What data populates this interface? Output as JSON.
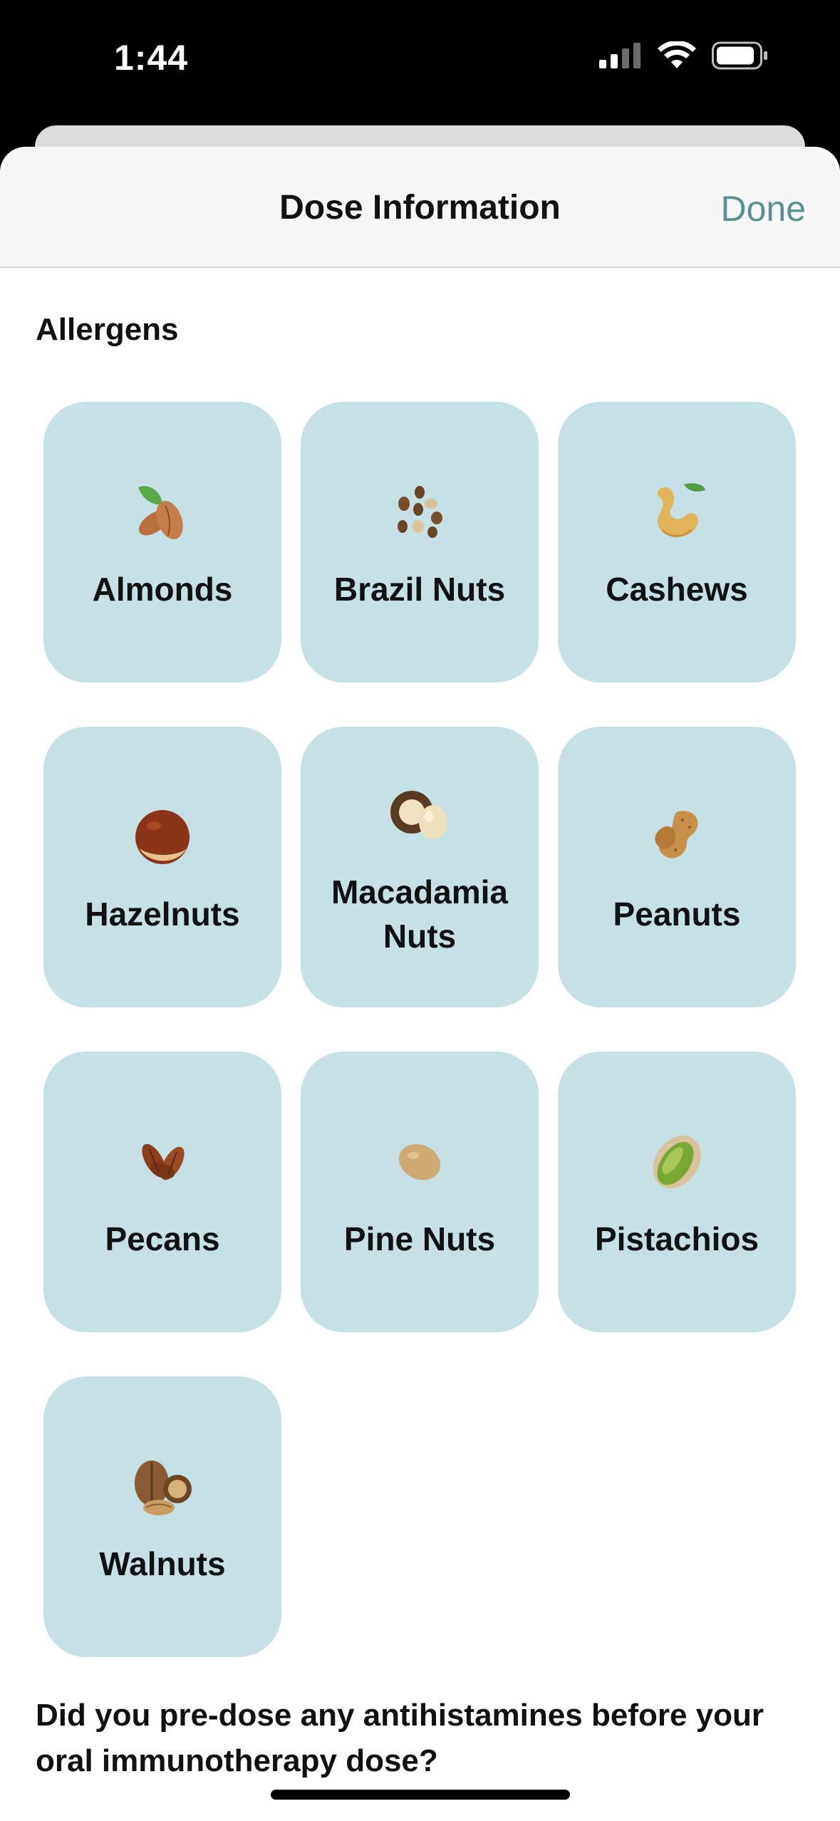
{
  "status_bar": {
    "time": "1:44",
    "icons": [
      "cellular-signal-icon",
      "wifi-icon",
      "battery-icon"
    ]
  },
  "nav": {
    "title": "Dose Information",
    "done_label": "Done",
    "done_color": "#5b8f91"
  },
  "allergens": {
    "section_title": "Allergens",
    "tile_color": "#c5e1e6",
    "items": [
      {
        "label": "Almonds",
        "icon": "almond-icon"
      },
      {
        "label": "Brazil Nuts",
        "icon": "brazil-nut-icon"
      },
      {
        "label": "Cashews",
        "icon": "cashew-icon"
      },
      {
        "label": "Hazelnuts",
        "icon": "hazelnut-icon"
      },
      {
        "label": "Macadamia Nuts",
        "icon": "macadamia-nut-icon"
      },
      {
        "label": "Peanuts",
        "icon": "peanut-icon"
      },
      {
        "label": "Pecans",
        "icon": "pecan-icon"
      },
      {
        "label": "Pine Nuts",
        "icon": "pine-nut-icon"
      },
      {
        "label": "Pistachios",
        "icon": "pistachio-icon"
      },
      {
        "label": "Walnuts",
        "icon": "walnut-icon"
      }
    ]
  },
  "question": {
    "text": "Did you pre-dose any antihistamines before your oral immunotherapy dose?"
  }
}
